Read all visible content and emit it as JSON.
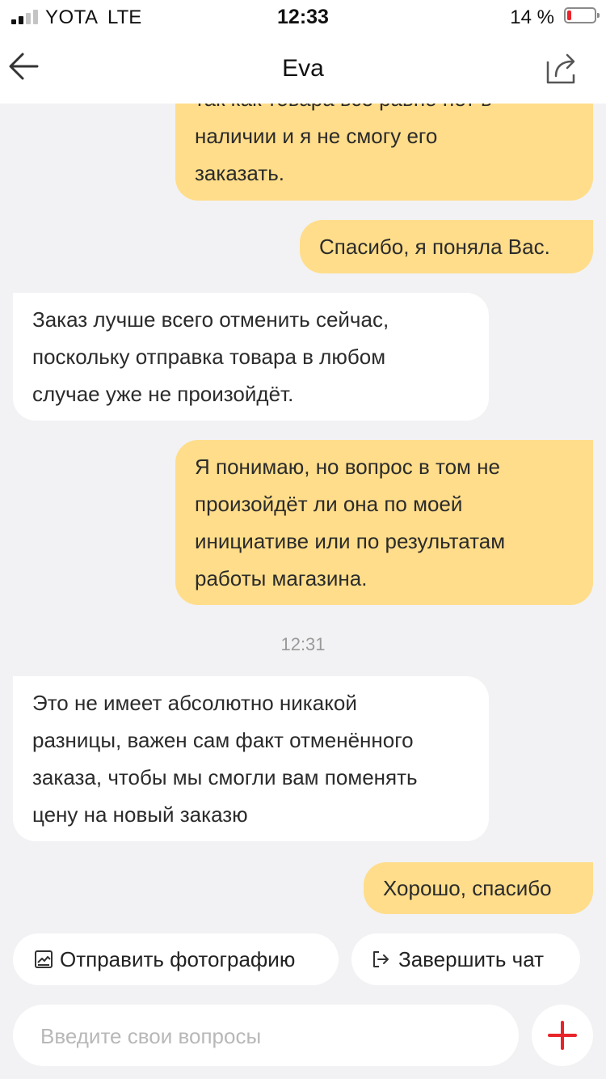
{
  "status_bar": {
    "carrier": "YOTA",
    "network": "LTE",
    "time": "12:33",
    "battery": "14 %"
  },
  "header": {
    "title": "Eva"
  },
  "messages": [
    {
      "side": "out",
      "lines": [
        "так как товара все равно нет в",
        "наличии и я не смогу его",
        "заказать."
      ]
    },
    {
      "side": "out",
      "lines": [
        "Спасибо, я поняла Вас."
      ]
    },
    {
      "side": "in",
      "lines": [
        "Заказ лучше всего отменить сейчас,",
        "поскольку отправка товара в любом",
        "случае уже не произойдёт."
      ]
    },
    {
      "side": "out",
      "lines": [
        "Я понимаю, но вопрос в том не",
        "произойдёт ли она по моей",
        "инициативе или по результатам",
        "работы магазина."
      ]
    },
    {
      "side": "in",
      "lines": [
        "Это не имеет абсолютно никакой",
        "разницы, важен сам факт отменённого",
        "заказа, чтобы мы смогли вам поменять",
        "цену на новый заказю"
      ]
    },
    {
      "side": "out",
      "lines": [
        "Хорошо, спасибо"
      ]
    }
  ],
  "timestamp": "12:31",
  "actions": {
    "send_photo": "Отправить фотографию",
    "end_chat": "Завершить чат"
  },
  "input": {
    "placeholder": "Введите свои вопросы",
    "value": ""
  },
  "colors": {
    "outgoing_bubble": "#ffdd8a",
    "incoming_bubble": "#ffffff",
    "background": "#f2f2f4",
    "accent_red": "#e8232a"
  }
}
